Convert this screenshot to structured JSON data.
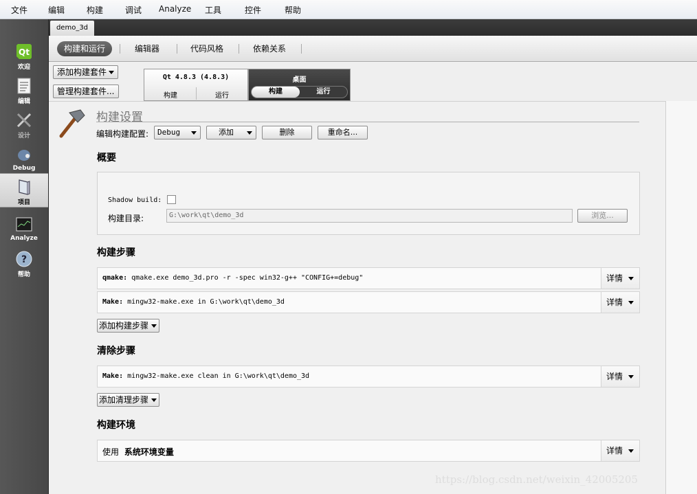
{
  "menu": [
    "文件",
    "编辑",
    "构建",
    "调试",
    "Analyze",
    "工具",
    "控件",
    "帮助"
  ],
  "modes": [
    {
      "label": "欢迎",
      "icon": "qt-logo-icon"
    },
    {
      "label": "编辑",
      "icon": "document-icon"
    },
    {
      "label": "设计",
      "icon": "design-tools-icon"
    },
    {
      "label": "Debug",
      "icon": "debug-bug-icon"
    },
    {
      "label": "项目",
      "icon": "project-folder-icon"
    },
    {
      "label": "Analyze",
      "icon": "analyze-monitor-icon"
    },
    {
      "label": "帮助",
      "icon": "help-icon"
    }
  ],
  "document_tab": "demo_3d",
  "subtabs": [
    "构建和运行",
    "编辑器",
    "代码风格",
    "依赖关系"
  ],
  "kit_buttons": {
    "add": "添加构建套件",
    "manage": "管理构建套件..."
  },
  "kits": {
    "qt": {
      "title": "Qt 4.8.3 (4.8.3)",
      "build": "构建",
      "run": "运行"
    },
    "desktop": {
      "title": "桌面",
      "build": "构建",
      "run": "运行"
    }
  },
  "build_settings": {
    "title": "构建设置",
    "edit_config_label": "编辑构建配置:",
    "config_value": "Debug",
    "add_label": "添加",
    "delete_label": "删除",
    "rename_label": "重命名..."
  },
  "overview": {
    "title": "概要",
    "shadow_build_label": "Shadow build:",
    "shadow_build_checked": false,
    "build_dir_label": "构建目录:",
    "build_dir_value": "G:\\work\\qt\\demo_3d",
    "browse_label": "浏览..."
  },
  "build_steps": {
    "title": "构建步骤",
    "steps": [
      {
        "name": "qmake:",
        "command": "qmake.exe demo_3d.pro -r -spec win32-g++ \"CONFIG+=debug\""
      },
      {
        "name": "Make:",
        "command": "mingw32-make.exe in G:\\work\\qt\\demo_3d"
      }
    ],
    "add_label": "添加构建步骤"
  },
  "clean_steps": {
    "title": "清除步骤",
    "steps": [
      {
        "name": "Make:",
        "command": "mingw32-make.exe clean in G:\\work\\qt\\demo_3d"
      }
    ],
    "add_label": "添加清理步骤"
  },
  "build_env": {
    "title": "构建环境",
    "use_label": "使用",
    "env_label": "系统环境变量"
  },
  "details_label": "详情",
  "watermark": "https://blog.csdn.net/weixin_42005205"
}
